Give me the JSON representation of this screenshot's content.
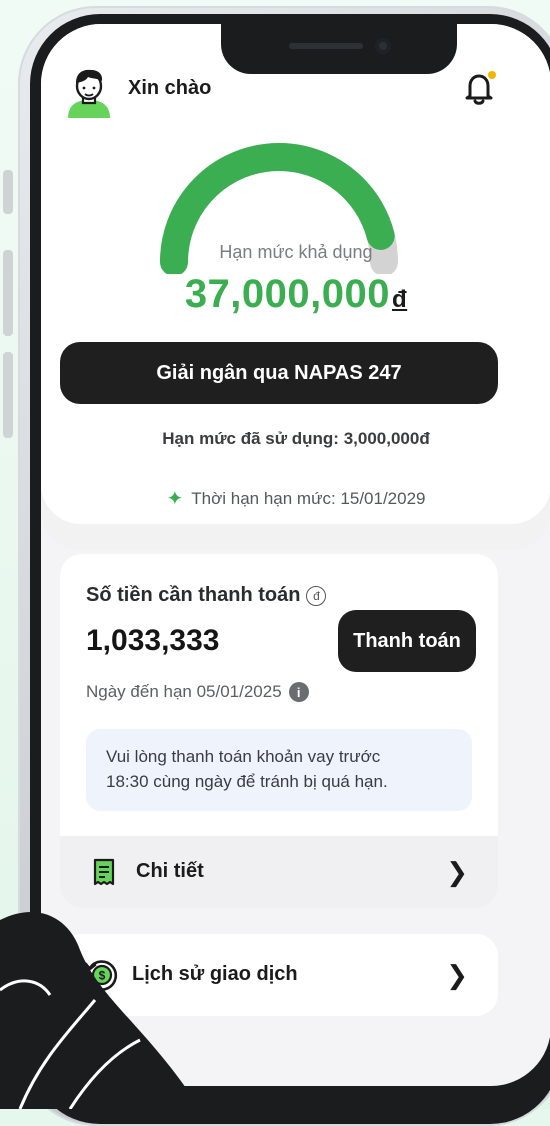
{
  "header": {
    "greeting": "Xin chào",
    "has_notification": true
  },
  "credit": {
    "gauge_fill_fraction": 0.92,
    "available_label": "Hạn mức khả dụng",
    "available_value": "37,000,000",
    "currency": "đ",
    "disburse_button": "Giải ngân qua NAPAS 247",
    "used_text": "Hạn mức đã sử dụng: 3,000,000đ",
    "expiry_text": "Thời hạn hạn mức: 15/01/2029"
  },
  "payment": {
    "title": "Số tiền cần thanh toán",
    "title_badge": "đ",
    "amount": "1,033,333",
    "pay_button": "Thanh toán",
    "due_text": "Ngày đến hạn 05/01/2025",
    "notice_line1": "Vui lòng thanh toán khoản vay trước",
    "notice_line2": "18:30 cùng ngày để tránh bị quá hạn.",
    "detail_label": "Chi tiết"
  },
  "history": {
    "label": "Lịch sử giao dịch"
  },
  "colors": {
    "accent": "#3aae50",
    "gauge_track": "#d3d3d3",
    "button_dark": "#1f1f1f",
    "notice_bg": "#eef3fc",
    "notification_dot": "#f5b400"
  },
  "icons": [
    "user-avatar-icon",
    "bell-icon",
    "sparkle-icon",
    "info-icon",
    "receipt-icon",
    "money-history-icon",
    "chevron-right-icon"
  ]
}
